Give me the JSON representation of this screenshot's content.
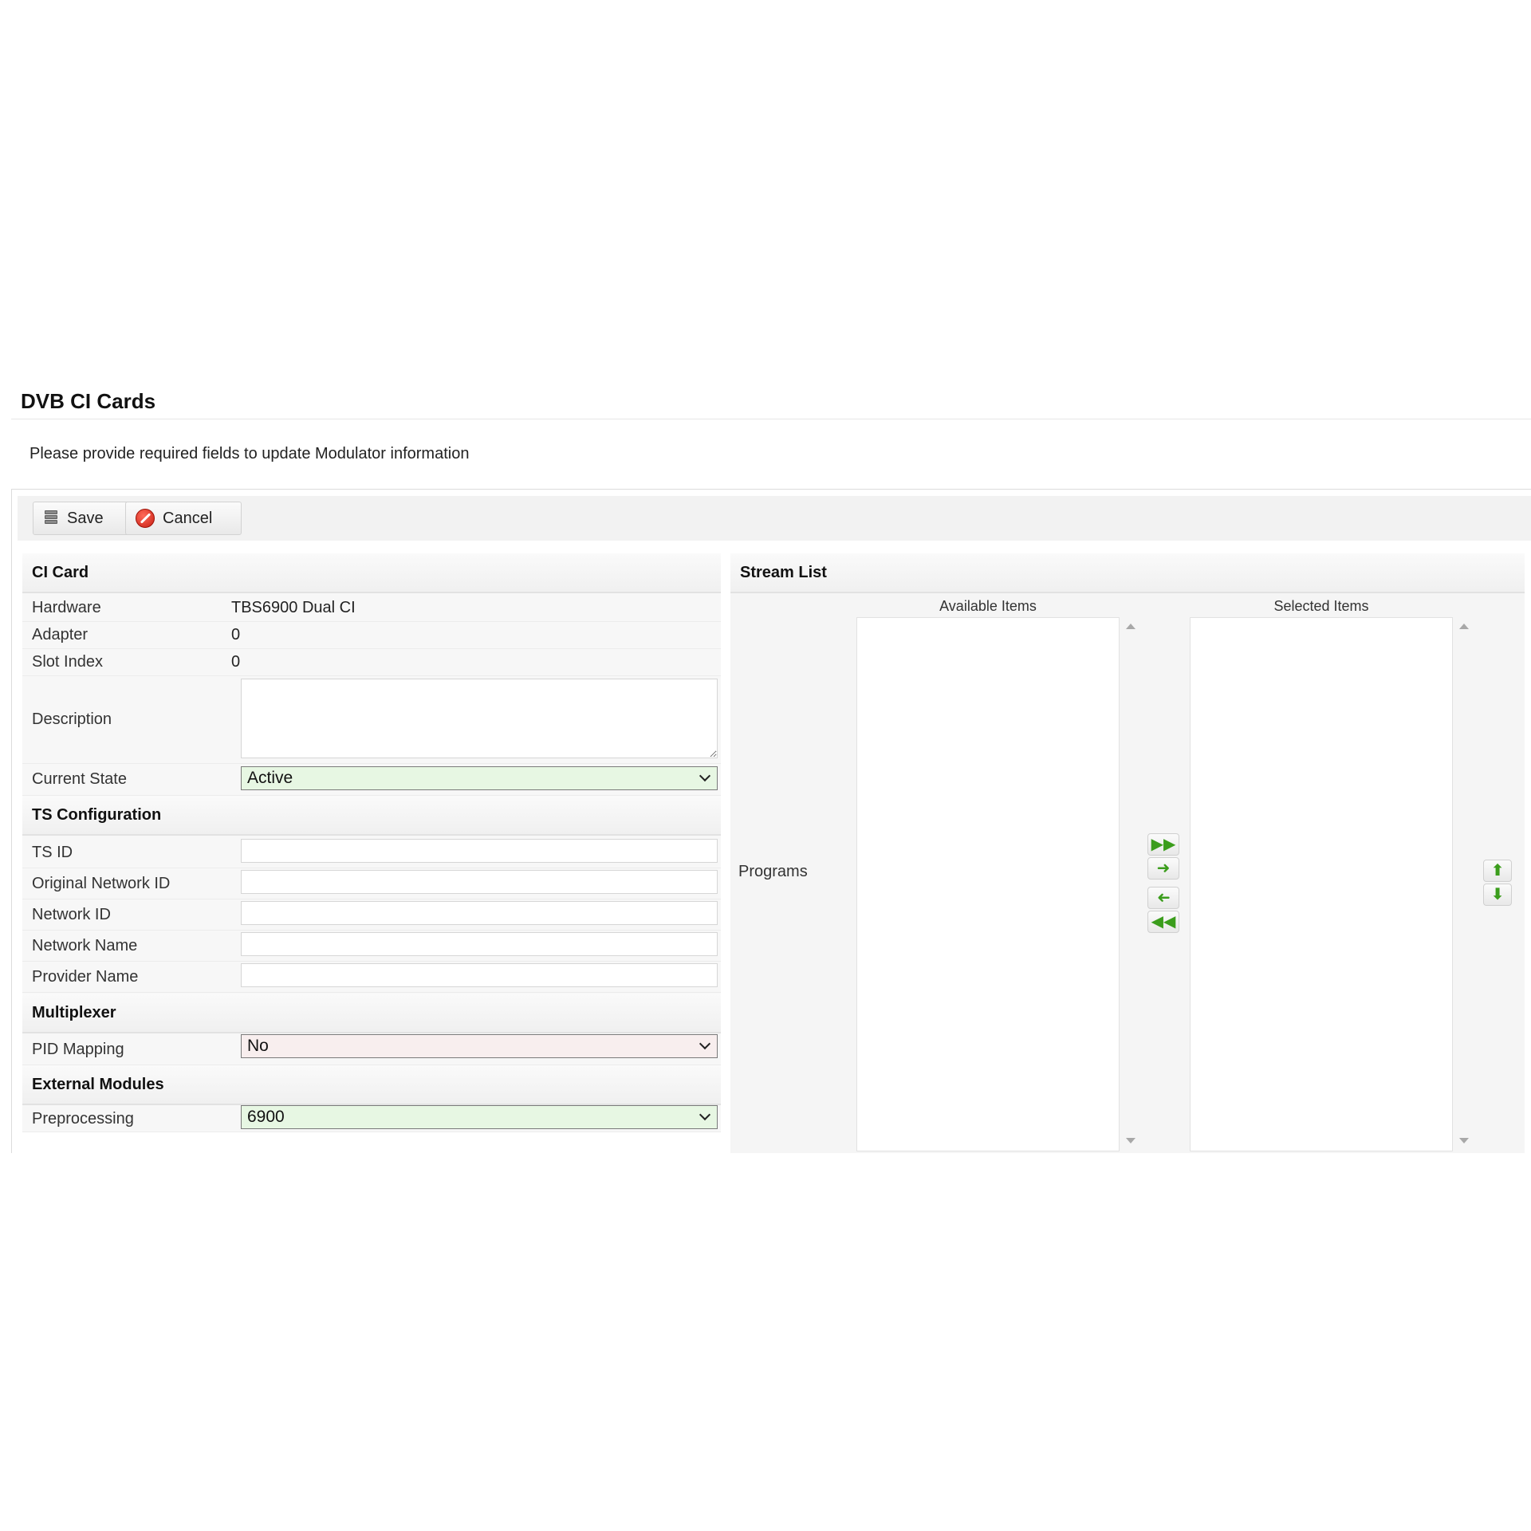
{
  "page": {
    "title": "DVB CI Cards",
    "subtitle": "Please provide required fields to update Modulator information"
  },
  "toolbar": {
    "save_label": "Save",
    "cancel_label": "Cancel"
  },
  "ci_card": {
    "header": "CI Card",
    "hardware_label": "Hardware",
    "hardware_value": "TBS6900 Dual CI",
    "adapter_label": "Adapter",
    "adapter_value": "0",
    "slot_index_label": "Slot Index",
    "slot_index_value": "0",
    "description_label": "Description",
    "description_value": "",
    "current_state_label": "Current State",
    "current_state_value": "Active"
  },
  "ts_configuration": {
    "header": "TS Configuration",
    "ts_id_label": "TS ID",
    "ts_id_value": "",
    "original_network_id_label": "Original Network ID",
    "original_network_id_value": "",
    "network_id_label": "Network ID",
    "network_id_value": "",
    "network_name_label": "Network Name",
    "network_name_value": "",
    "provider_name_label": "Provider Name",
    "provider_name_value": ""
  },
  "multiplexer": {
    "header": "Multiplexer",
    "pid_mapping_label": "PID Mapping",
    "pid_mapping_value": "No"
  },
  "external_modules": {
    "header": "External Modules",
    "preprocessing_label": "Preprocessing",
    "preprocessing_value": "6900"
  },
  "stream_list": {
    "header": "Stream List",
    "programs_label": "Programs",
    "available_header": "Available Items",
    "selected_header": "Selected Items",
    "available_items": [],
    "selected_items": []
  },
  "icons": {
    "save": "database-save-icon",
    "cancel": "cancel-circle-icon",
    "move_all_right": "double-arrow-right-icon",
    "move_right": "arrow-right-icon",
    "move_left": "arrow-left-icon",
    "move_all_left": "double-arrow-left-icon",
    "move_up": "arrow-up-icon",
    "move_down": "arrow-down-icon"
  },
  "colors": {
    "select_active_bg": "#e7f7e3",
    "select_no_bg": "#f8eeee",
    "arrow_green": "#3b9d1c"
  }
}
